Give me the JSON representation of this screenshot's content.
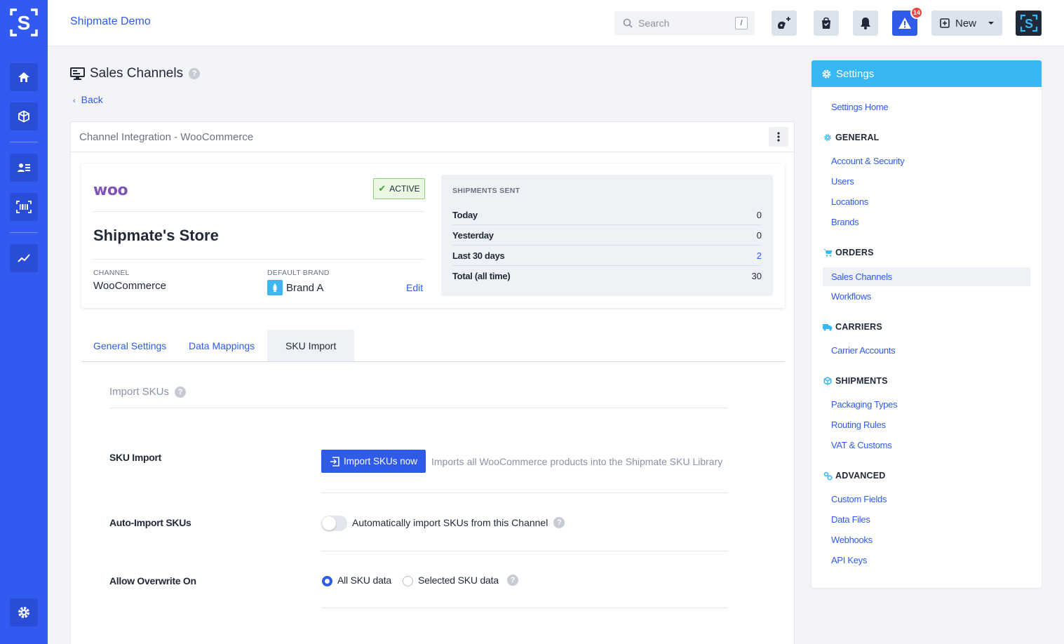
{
  "app": {
    "name": "Shipmate Demo"
  },
  "topbar": {
    "search_placeholder": "Search",
    "search_shortcut": "/",
    "alert_count": "14",
    "new_label": "New"
  },
  "page": {
    "title": "Sales Channels",
    "back_label": "Back"
  },
  "card": {
    "title": "Channel Integration - WooCommerce"
  },
  "store": {
    "logo_text": "woo",
    "status": "ACTIVE",
    "name": "Shipmate's Store",
    "channel_label": "CHANNEL",
    "channel_value": "WooCommerce",
    "brand_label": "DEFAULT BRAND",
    "brand_value": "Brand A",
    "edit_label": "Edit"
  },
  "stats": {
    "title": "SHIPMENTS SENT",
    "rows": [
      {
        "label": "Today",
        "value": "0"
      },
      {
        "label": "Yesterday",
        "value": "0"
      },
      {
        "label": "Last 30 days",
        "value": "2"
      },
      {
        "label": "Total (all time)",
        "value": "30"
      }
    ]
  },
  "tabs": [
    {
      "label": "General Settings"
    },
    {
      "label": "Data Mappings"
    },
    {
      "label": "SKU Import"
    }
  ],
  "section": {
    "title": "Import SKUs",
    "sku_import_label": "SKU Import",
    "import_button": "Import SKUs now",
    "import_desc": "Imports all WooCommerce products into the Shipmate SKU Library",
    "auto_import_label": "Auto-Import SKUs",
    "auto_import_toggle_label": "Automatically import SKUs from this Channel",
    "overwrite_label": "Allow Overwrite On",
    "overwrite_options": [
      "All SKU data",
      "Selected SKU data"
    ],
    "overwrite_selected": "All SKU data"
  },
  "settings": {
    "title": "Settings",
    "home": "Settings Home",
    "groups": [
      {
        "title": "GENERAL",
        "items": [
          "Account & Security",
          "Users",
          "Locations",
          "Brands"
        ]
      },
      {
        "title": "ORDERS",
        "items": [
          "Sales Channels",
          "Workflows"
        ]
      },
      {
        "title": "CARRIERS",
        "items": [
          "Carrier Accounts"
        ]
      },
      {
        "title": "SHIPMENTS",
        "items": [
          "Packaging Types",
          "Routing Rules",
          "VAT & Customs"
        ]
      },
      {
        "title": "ADVANCED",
        "items": [
          "Custom Fields",
          "Data Files",
          "Webhooks",
          "API Keys"
        ]
      }
    ],
    "selected": "Sales Channels"
  },
  "colors": {
    "brand": "#3259f0",
    "accent": "#2f5be8",
    "settings_header": "#37b8f5",
    "active_green": "#3fa52a"
  }
}
